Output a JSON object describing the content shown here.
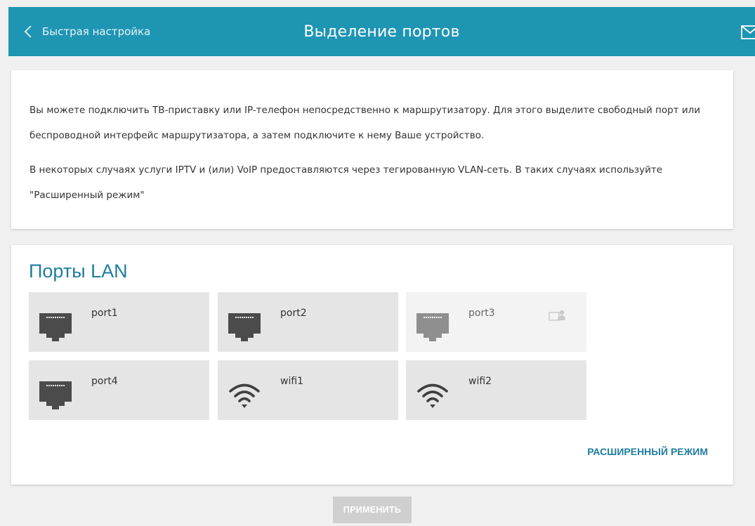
{
  "header": {
    "back_label": "Быстрая настройка",
    "title": "Выделение портов",
    "back_icon": "chevron-left-icon",
    "mail_icon": "mail-icon"
  },
  "intro": {
    "paragraph1": "Вы можете подключить ТВ-приставку или IP-телефон непосредственно к маршрутизатору. Для этого выделите свободный порт или беспроводной интерфейс маршрутизатора, а затем подключите к нему Ваше устройство.",
    "paragraph2": "В некоторых случаях услуги IPTV и (или) VoIP предоставляются через тегированную VLAN-сеть. В таких случаях используйте \"Расширенный режим\""
  },
  "lan_section": {
    "title": "Порты LAN",
    "ports": [
      {
        "label": "port1",
        "icon": "ethernet-port-icon",
        "state": "available"
      },
      {
        "label": "port2",
        "icon": "ethernet-port-icon",
        "state": "available"
      },
      {
        "label": "port3",
        "icon": "ethernet-port-icon",
        "state": "used",
        "badge_icon": "assigned-device-icon"
      },
      {
        "label": "port4",
        "icon": "ethernet-port-icon",
        "state": "available"
      },
      {
        "label": "wifi1",
        "icon": "wifi-icon",
        "state": "available"
      },
      {
        "label": "wifi2",
        "icon": "wifi-icon",
        "state": "available"
      }
    ],
    "advanced_link": "РАСШИРЕННЫЙ РЕЖИМ"
  },
  "apply_button": {
    "label": "ПРИМЕНИТЬ",
    "enabled": false
  },
  "colors": {
    "accent": "#1e95b3",
    "link": "#1e7da0",
    "background": "#f0f0f0",
    "tile": "#e5e5e5",
    "tile_disabled": "#f3f3f3",
    "button_disabled": "#cfcfcf"
  }
}
